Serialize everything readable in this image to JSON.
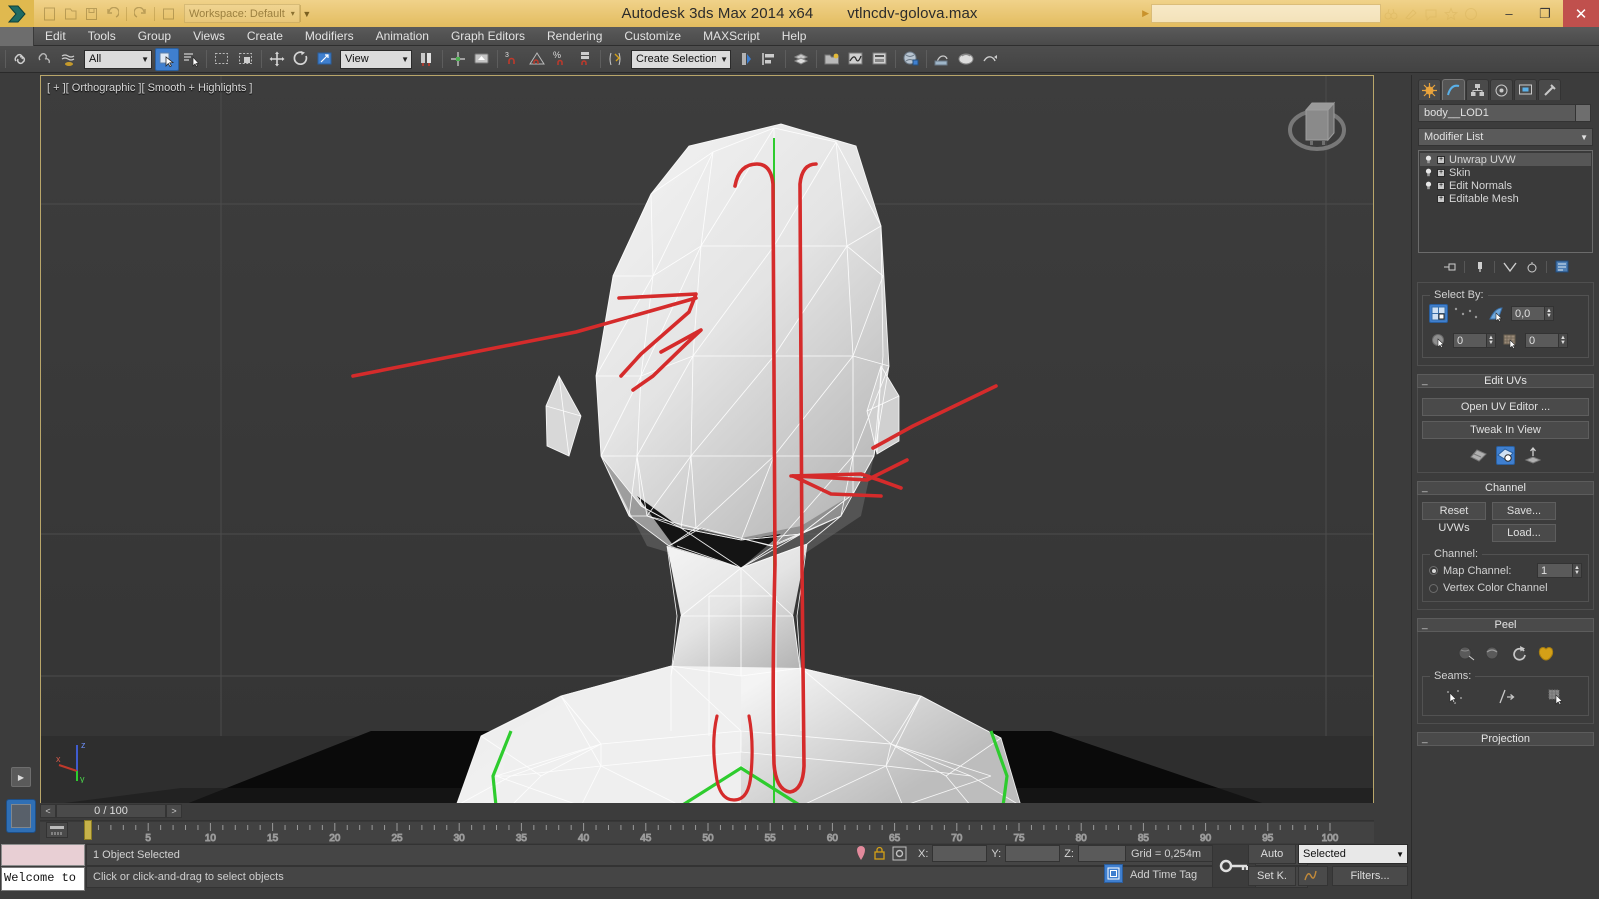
{
  "titlebar": {
    "app_title": "Autodesk 3ds Max  2014 x64",
    "file_name": "vtlncdv-golova.max",
    "workspace_label": "Workspace: Default",
    "search_placeholder": "",
    "minimize": "–",
    "restore": "❐",
    "close": "✕"
  },
  "menu": {
    "items": [
      {
        "label": "Edit"
      },
      {
        "label": "Tools"
      },
      {
        "label": "Group"
      },
      {
        "label": "Views"
      },
      {
        "label": "Create"
      },
      {
        "label": "Modifiers"
      },
      {
        "label": "Animation"
      },
      {
        "label": "Graph Editors"
      },
      {
        "label": "Rendering"
      },
      {
        "label": "Customize"
      },
      {
        "label": "MAXScript"
      },
      {
        "label": "Help"
      }
    ]
  },
  "toolbar": {
    "selection_filter": "All",
    "reference_coord": "View",
    "named_selection_sets": "Create Selection Se"
  },
  "viewport": {
    "label": "[ + ][ Orthographic ][ Smooth + Highlights ]",
    "axis_x": "x",
    "axis_y": "y",
    "axis_z": "z"
  },
  "command_panel": {
    "object_name": "body__LOD1",
    "modifier_list_label": "Modifier List",
    "modifier_stack": [
      {
        "label": "Unwrap UVW",
        "selected": true
      },
      {
        "label": "Skin",
        "selected": false
      },
      {
        "label": "Edit Normals",
        "selected": false
      },
      {
        "label": "Editable Mesh",
        "selected": false
      }
    ],
    "select_by": {
      "group_label": "Select By:",
      "angle_value": "0,0",
      "field2_value": "0",
      "field3_value": "0"
    },
    "edit_uvs": {
      "title": "Edit UVs",
      "open_uv_editor": "Open UV Editor ...",
      "tweak_in_view": "Tweak In View"
    },
    "channel": {
      "title": "Channel",
      "reset_uvws": "Reset UVWs",
      "save": "Save...",
      "load": "Load...",
      "group_label": "Channel:",
      "map_channel_label": "Map Channel:",
      "map_channel_value": "1",
      "vertex_color_label": "Vertex Color Channel"
    },
    "peel": {
      "title": "Peel",
      "seams_label": "Seams:"
    },
    "projection": {
      "title": "Projection"
    }
  },
  "timebar": {
    "current_frame": "0 / 100",
    "prev": "<",
    "next": ">",
    "ticks": [
      "5",
      "10",
      "15",
      "20",
      "25",
      "30",
      "35",
      "40",
      "45",
      "50",
      "55",
      "60",
      "65",
      "70",
      "75",
      "80",
      "85",
      "90",
      "95",
      "100"
    ]
  },
  "statusbar": {
    "mini_listener_text": "Welcome to",
    "selection_status": "1 Object Selected",
    "prompt": "Click or click-and-drag to select objects",
    "x_label": "X:",
    "y_label": "Y:",
    "z_label": "Z:",
    "x_value": "",
    "y_value": "",
    "z_value": "",
    "grid_info": "Grid = 0,254m",
    "add_time_tag": "Add Time Tag",
    "auto_key": "Auto",
    "set_key": "Set K.",
    "key_filter_selected": "Selected",
    "filters": "Filters...",
    "playback_frame": "0"
  },
  "colors": {
    "title_bar": "#e9c46a",
    "close_button": "#c0504d",
    "accent_blue": "#3f7fcf",
    "viewport_border": "#b9a66a",
    "seam_green": "#2ecc2e",
    "annotation_red": "#d52b2b",
    "panel_bg": "#3c3c3c"
  }
}
